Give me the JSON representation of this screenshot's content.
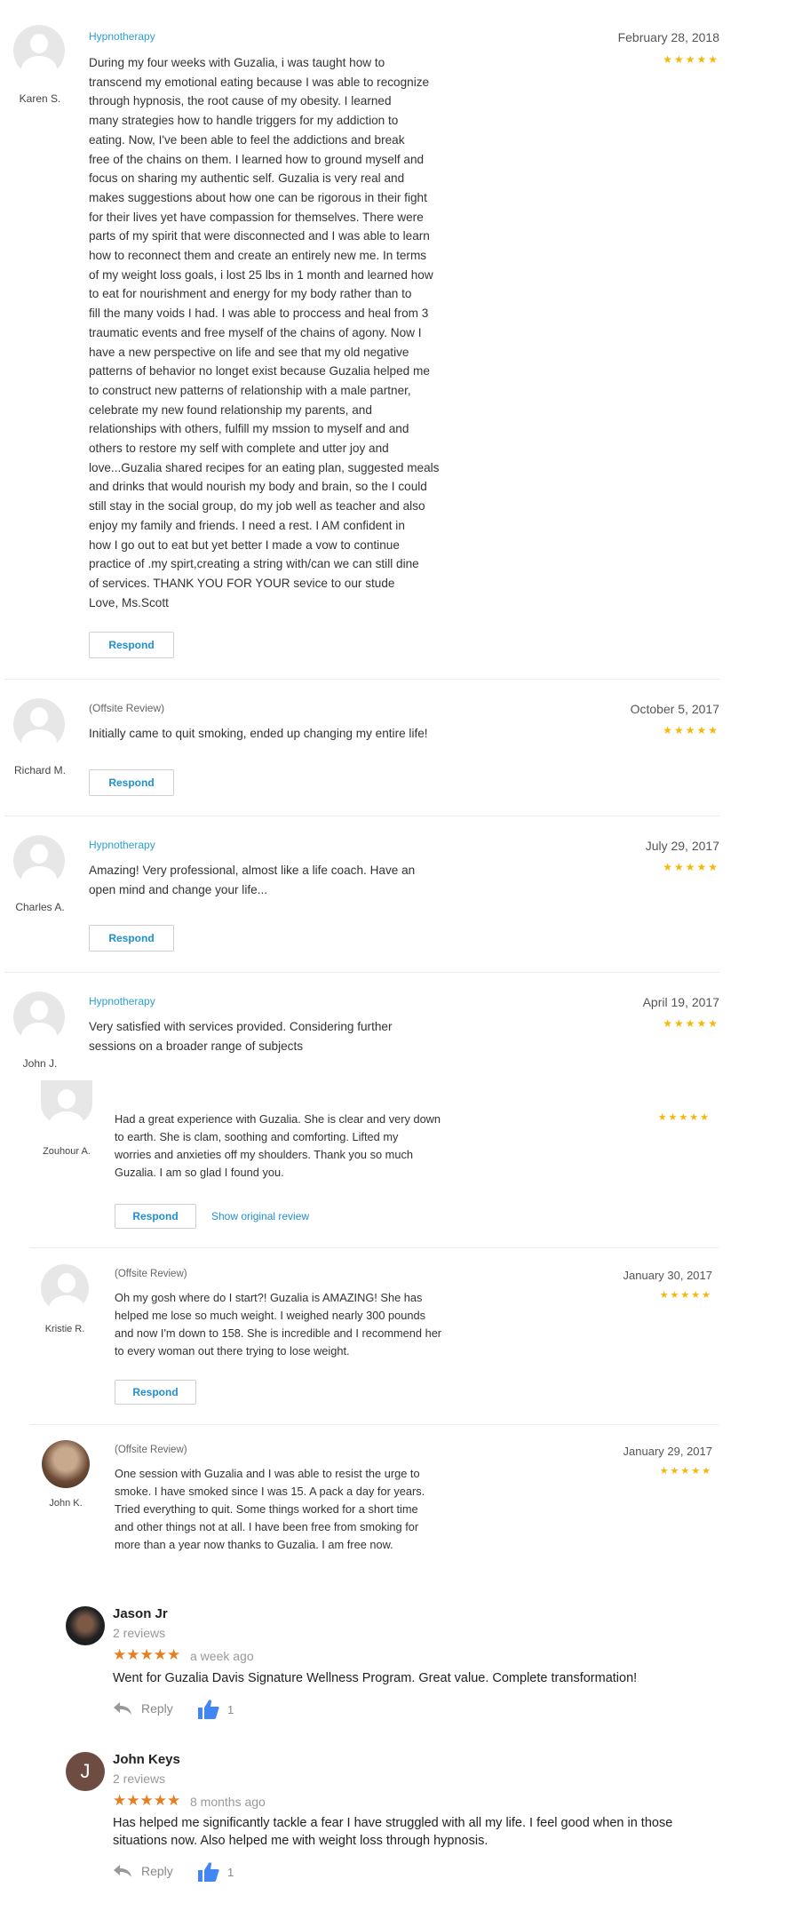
{
  "reviews": [
    {
      "name": "Karen S.",
      "category": "Hypnotherapy",
      "date": "February 28, 2018",
      "stars": "★★★★★",
      "text": "During my four weeks with Guzalia, i was taught how to\ntranscend my emotional eating because I was able to recognize\nthrough hypnosis, the root cause of my obesity. I learned\nmany strategies how to handle  triggers for my addiction to\neating.  Now, I've  been able to feel the addictions and  break\nfree of the chains on them.   I learned how to ground myself and\nfocus  on sharing my authentic self. Guzalia is very real and\nmakes suggestions about how one can be rigorous in their fight\nfor their lives yet  have compassion for themselves. There were\nparts of my spirit that were  disconnected and I was able to learn\nhow to reconnect  them and create an entirely new me. In terms\nof my weight loss goals, i lost 25 lbs in 1 month and learned how\nto eat for nourishment and energy for my body  rather than to\nfill the many voids  I had.  I was able to proccess and heal from 3\ntraumatic events and free myself  of the chains of agony. Now I\nhave a new perspective on life and see that my old negative\npatterns  of behavior no longet exist because Guzalia helped  me\nto  construct new patterns of relationship with a male partner,\ncelebrate my new found relationship my parents, and\nrelationships with others, fulfill my mssion to myself and and\nothers to restore my self with complete and utter  joy and\nlove...Guzalia shared recipes for an eating plan, suggested meals\nand drinks that would nourish my body and brain, so the I could\nstill stay in the social group,  do my job well as teacher and also\nenjoy my family and friends.  I need a rest. I AM    confident in\nhow I go out to eat but yet better I made a vow to continue\npractice of .my spirt,creating a string with/can we can still dine\nof services. THANK YOU FOR YOUR sevice to our stude\nLove, Ms.Scott",
      "respond": "Respond"
    },
    {
      "name": "Richard M.",
      "category": "(Offsite Review)",
      "date": "October 5, 2017",
      "stars": "★★★★★",
      "text": "Initially came to quit smoking, ended up changing my entire life!",
      "respond": "Respond"
    },
    {
      "name": "Charles A.",
      "category": "Hypnotherapy",
      "date": "July 29, 2017",
      "stars": "★★★★★",
      "text": "Amazing!  Very professional, almost like a life coach.  Have an\nopen mind and change your life...",
      "respond": "Respond"
    },
    {
      "name": "John J.",
      "category": "Hypnotherapy",
      "date": "April 19, 2017",
      "stars": "★★★★★",
      "text": "Very satisfied with services provided.  Considering further\nsessions on a broader range of subjects"
    }
  ],
  "reviews2": [
    {
      "name": "Zouhour A.",
      "stars": "★★★★★",
      "text": "Had a great experience with Guzalia. She is clear and very down\nto earth. She is clam, soothing and comforting. Lifted my\nworries and anxieties off my shoulders. Thank you so much\nGuzalia. I am so glad I found you.",
      "respond": "Respond",
      "show_original": "Show original review"
    },
    {
      "name": "Kristie R.",
      "category": "(Offsite Review)",
      "date": "January 30, 2017",
      "stars": "★★★★★",
      "text": "Oh my gosh where do I start?! Guzalia is AMAZING! She has\nhelped me lose so much weight. I weighed nearly 300 pounds\nand now I'm down to 158. She is incredible and I recommend her\nto every woman out there trying to lose weight.",
      "respond": "Respond"
    },
    {
      "name": "John K.",
      "category": "(Offsite Review)",
      "date": "January 29, 2017",
      "stars": "★★★★★",
      "text": "One session with Guzalia and I was able to resist the urge to\nsmoke.  I have smoked since I was 15.  A pack a day for years.\nTried everything to quit.  Some things worked for a short time\nand other things not at all.  I have been free from smoking for\nmore than a year now thanks to Guzalia.   I am free now."
    }
  ],
  "google_reviews": [
    {
      "name": "Jason Jr",
      "reviews_count": "2 reviews",
      "stars": "★★★★★",
      "time": "a week ago",
      "text": "Went for Guzalia Davis Signature Wellness Program. Great value. Complete transformation!",
      "reply": "Reply",
      "likes": "1"
    },
    {
      "name": "John Keys",
      "avatar_letter": "J",
      "reviews_count": "2 reviews",
      "stars": "★★★★★",
      "time": "8 months ago",
      "text": "Has helped me significantly tackle a fear I have struggled with all my life.  I feel good when in those\nsituations now.  Also helped me with weight loss through hypnosis.",
      "reply": "Reply",
      "likes": "1"
    }
  ],
  "colors": {
    "link_blue": "#1f8fd0",
    "category_blue": "#2a9fd6",
    "star_gold": "#f5b70a",
    "google_star_orange": "#e67e22",
    "like_blue": "#4285f4"
  }
}
